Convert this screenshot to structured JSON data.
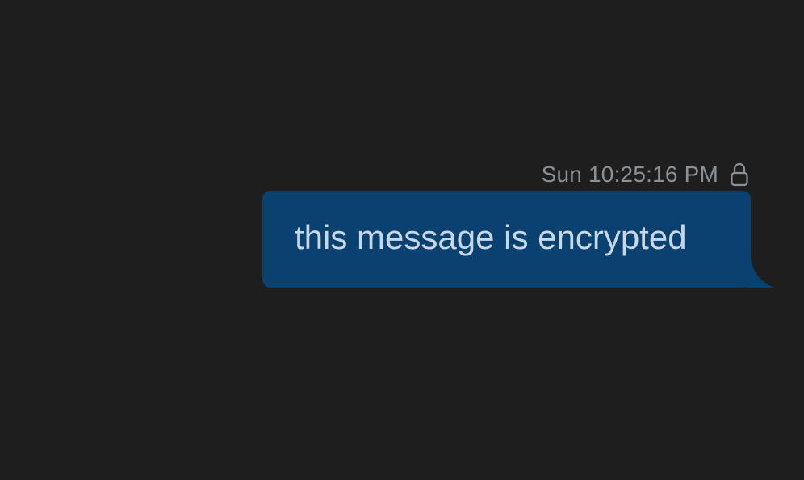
{
  "message": {
    "timestamp": "Sun 10:25:16 PM",
    "status_icon": "lock-icon",
    "text": "this message is encrypted"
  },
  "colors": {
    "background": "#1e1e1e",
    "bubble": "#094270",
    "message_text": "#c9d6e8",
    "meta_text": "#8a9297"
  }
}
